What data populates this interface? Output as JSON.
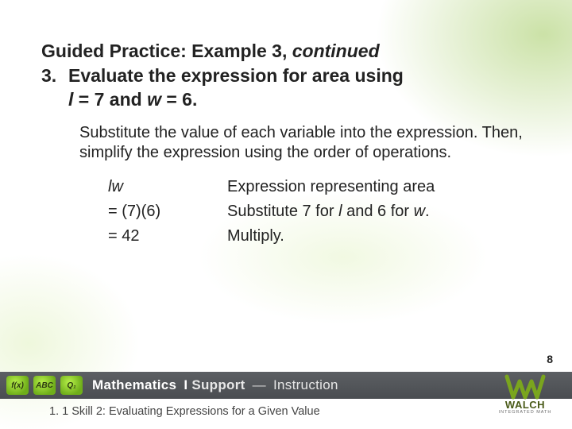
{
  "title": {
    "main": "Guided Practice: Example 3, ",
    "cont": "continued"
  },
  "step": {
    "num": "3.",
    "line1": "Evaluate the expression for area using",
    "line2_pre": "",
    "l_var": "l",
    "line2_mid": " = 7 and ",
    "w_var": "w",
    "line2_post": " = 6."
  },
  "body": "Substitute the value of each variable into the expression. Then, simplify the expression using the order of operations.",
  "table": {
    "rows": [
      {
        "left_html": "lw",
        "right": "Expression representing area"
      },
      {
        "left": "= (7)(6)",
        "right_html": "sub76"
      },
      {
        "left": "= 42",
        "right": "Multiply."
      }
    ],
    "r0_left_l": "l",
    "r0_left_w": "w",
    "r1_right_a": "Substitute 7 for ",
    "r1_right_l": "l",
    "r1_right_b": " and 6 for ",
    "r1_right_w": "w",
    "r1_right_c": "."
  },
  "page_number": "8",
  "footer": {
    "chips": [
      "f(x)",
      "ABC",
      "Q₁"
    ],
    "brand1": "Mathematics",
    "brand2": "Support",
    "brand3": "Instruction",
    "caption": "1. 1 Skill 2: Evaluating Expressions for a Given Value",
    "logo_text": "WALCH",
    "logo_sub": "INTEGRATED MATH"
  }
}
